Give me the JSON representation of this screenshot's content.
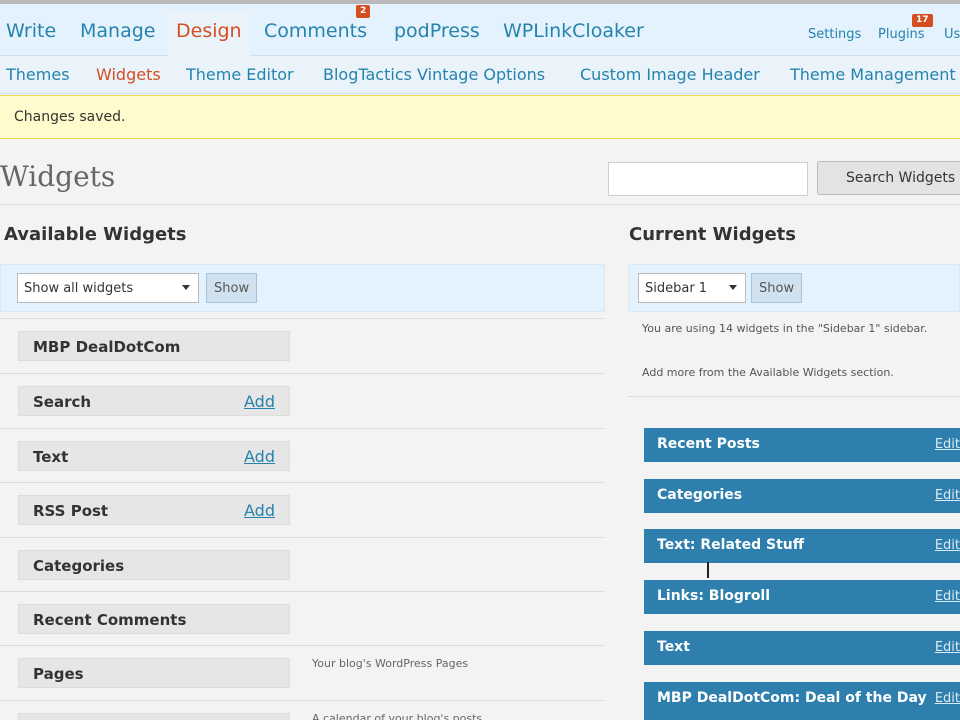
{
  "main_nav": {
    "items": [
      "Write",
      "Manage",
      "Design",
      "Comments",
      "podPress",
      "WPLinkCloaker"
    ],
    "active": "Design",
    "comments_badge": "2",
    "utility": [
      "Settings",
      "Plugins",
      "Us"
    ],
    "plugins_badge": "17"
  },
  "sub_nav": {
    "items": [
      "Themes",
      "Widgets",
      "Theme Editor",
      "BlogTactics Vintage Options",
      "Custom Image Header",
      "Theme Management"
    ],
    "active": "Widgets"
  },
  "notice": "Changes saved.",
  "page_title": "Widgets",
  "search": {
    "button_label": "Search Widgets",
    "value": ""
  },
  "available": {
    "heading": "Available Widgets",
    "filter": {
      "selected": "Show all widgets",
      "show_label": "Show"
    },
    "widgets": [
      {
        "name": "MBP DealDotCom",
        "action": "",
        "desc": ""
      },
      {
        "name": "Search",
        "action": "Add",
        "desc": ""
      },
      {
        "name": "Text",
        "action": "Add",
        "desc": ""
      },
      {
        "name": "RSS Post",
        "action": "Add",
        "desc": ""
      },
      {
        "name": "Categories",
        "action": "",
        "desc": ""
      },
      {
        "name": "Recent Comments",
        "action": "",
        "desc": ""
      },
      {
        "name": "Pages",
        "action": "",
        "desc": "Your blog's WordPress Pages"
      },
      {
        "name": "",
        "action": "",
        "desc": "A calendar of your blog's posts"
      }
    ]
  },
  "current": {
    "heading": "Current Widgets",
    "sidebar": {
      "selected": "Sidebar 1",
      "show_label": "Show"
    },
    "info1": "You are using 14 widgets in the \"Sidebar 1\" sidebar.",
    "info2": "Add more from the Available Widgets section.",
    "widgets": [
      {
        "name": "Recent Posts",
        "edit": "Edit"
      },
      {
        "name": "Categories",
        "edit": "Edit"
      },
      {
        "name": "Text: Related Stuff",
        "edit": "Edit"
      },
      {
        "name": "Links: Blogroll",
        "edit": "Edit"
      },
      {
        "name": "Text",
        "edit": "Edit"
      },
      {
        "name": "MBP DealDotCom: Deal of the Day",
        "edit": "Edit"
      }
    ]
  },
  "colors": {
    "link": "#2583ad",
    "active": "#d54e21",
    "notice_bg": "#fffbcc",
    "widget_bar": "#2e7fad"
  }
}
